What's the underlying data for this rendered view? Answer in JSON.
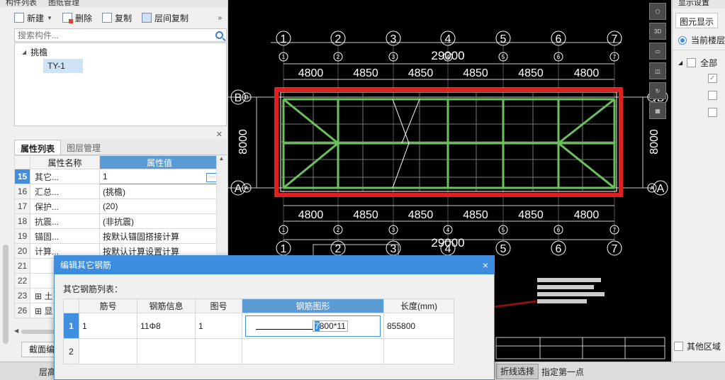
{
  "left_panel": {
    "top_tabs": [
      "构件列表",
      "图纸管理"
    ],
    "toolbar": {
      "new_label": "新建",
      "delete_label": "删除",
      "copy_label": "复制",
      "floor_copy_label": "层间复制",
      "more_label": "»"
    },
    "search_placeholder": "搜索构件...",
    "tree": {
      "root_label": "挑檐",
      "child_label": "TY-1"
    },
    "props_tabs": [
      "属性列表",
      "图层管理"
    ],
    "props_headers": [
      "属性名称",
      "属性值"
    ],
    "props_rows": [
      {
        "num": "15",
        "name": "其它...",
        "value": "1"
      },
      {
        "num": "16",
        "name": "汇总...",
        "value": "(挑檐)"
      },
      {
        "num": "17",
        "name": "保护...",
        "value": "(20)"
      },
      {
        "num": "18",
        "name": "抗震...",
        "value": "(非抗震)"
      },
      {
        "num": "19",
        "name": "锚固...",
        "value": "按默认锚固搭接计算"
      },
      {
        "num": "20",
        "name": "计算...",
        "value": "按默认计算设置计算"
      },
      {
        "num": "21",
        "name": "",
        "value": ""
      },
      {
        "num": "22",
        "name": "",
        "value": ""
      },
      {
        "num": "23",
        "name": "土",
        "value": ""
      },
      {
        "num": "26",
        "name": "显",
        "value": ""
      }
    ],
    "section_button": "截面编"
  },
  "canvas": {
    "axis_top": [
      "1",
      "2",
      "3",
      "4",
      "5",
      "6",
      "7"
    ],
    "total_dim": "29000",
    "span_dims": [
      "4800",
      "4850",
      "4850",
      "4850",
      "4850",
      "4800"
    ],
    "axis_side": [
      "B",
      "A"
    ],
    "height_dim": "8000"
  },
  "right_panel": {
    "title": "显示设置",
    "tab_label": "图元显示",
    "radio_label": "当前楼层",
    "all_label": "全部",
    "other_label": "其他区域"
  },
  "status_bar": {
    "left_text": "层高",
    "mode_label": "折线选择",
    "hint": "指定第一点"
  },
  "dialog": {
    "title": "编辑其它钢筋",
    "close": "×",
    "subtitle": "其它钢筋列表：",
    "headers": [
      "筋号",
      "钢筋信息",
      "图号",
      "钢筋图形",
      "长度(mm)"
    ],
    "rows": [
      {
        "num": "1",
        "bar_no": "1",
        "rebar_info": "11Φ8",
        "figure_no": "1",
        "shape_cursor": "7",
        "shape_text": "800*11",
        "length": "855800"
      },
      {
        "num": "2",
        "bar_no": "",
        "rebar_info": "",
        "figure_no": "",
        "shape_cursor": "",
        "shape_text": "",
        "length": ""
      }
    ]
  }
}
